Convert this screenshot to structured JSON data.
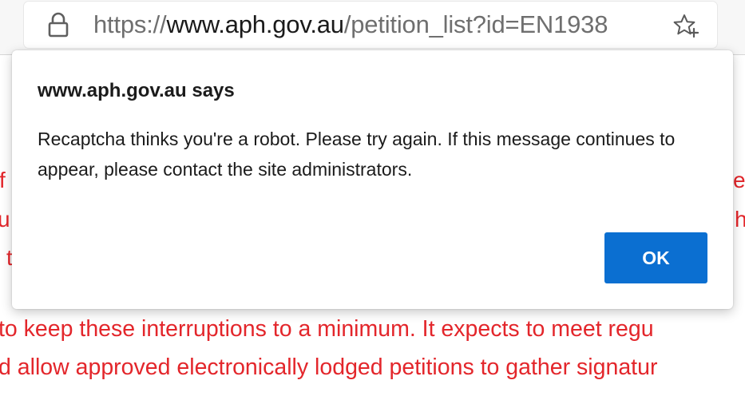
{
  "browser": {
    "url": {
      "scheme": "https://",
      "host": "www.aph.gov.au",
      "path": "/petition_list?id=EN1938"
    },
    "icons": {
      "lock": "lock-icon",
      "favorite": "star-add-icon"
    }
  },
  "page": {
    "text_color": "#e3262b",
    "lines": [
      "to keep these interruptions to a minimum. It expects to meet regu",
      "d allow approved electronically lodged petitions to gather signatur"
    ],
    "left_fragments": [
      "f",
      "u",
      "t"
    ],
    "right_fragments": [
      "es",
      "h"
    ]
  },
  "dialog": {
    "title": "www.aph.gov.au says",
    "message": "Recaptcha thinks you're a robot. Please try again. If this message continues to appear, please contact the site administrators.",
    "ok_label": "OK",
    "accent_color": "#0b6fd1"
  }
}
